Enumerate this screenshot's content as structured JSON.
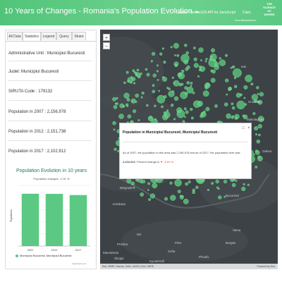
{
  "header": {
    "title": "10 Years of Changes - Romania's Population Evolution",
    "links": [
      "Calcite Theme",
      "ArcGIS API for JavaScript",
      "Claro"
    ],
    "author": "Ionut Alexandrescu",
    "logo_lines": [
      "THE",
      "SCIENCE",
      "OF",
      "WHERE"
    ]
  },
  "tabs": [
    "All Data",
    "Statistics",
    "Legend",
    "Query",
    "Share"
  ],
  "active_tab": "Statistics",
  "fields": [
    {
      "label": "Administrative Unit :",
      "value": "Municipiul Bucuresti"
    },
    {
      "label": "Judet:",
      "value": "Municipiul Bucuresti"
    },
    {
      "label": "SIRUTA Code : ",
      "value": "179132"
    },
    {
      "label": "Population in 2007 : ",
      "value": "2,156,978"
    },
    {
      "label": "Population in 2012 : ",
      "value": "2,151,738"
    },
    {
      "label": "Population in 2017 : ",
      "value": "2,102,912"
    }
  ],
  "chart_data": {
    "type": "bar",
    "title": "Population Evolution in 10 years",
    "subtitle": "Population changes: -2.51 %",
    "ylabel": "Population",
    "categories": [
      "2007",
      "2012",
      "2017"
    ],
    "series": [
      {
        "name": "Municipiul Bucuresti, Municipiul Bucuresti",
        "values": [
          2156978,
          2151738,
          2102912
        ]
      }
    ],
    "ylim": [
      0,
      2500000
    ],
    "grid": true,
    "legend_position": "bottom",
    "color": "#5bc983",
    "credit": "Highcharts.com"
  },
  "map": {
    "labels": [
      {
        "text": "Iasi"
      },
      {
        "text": "Chisinau"
      },
      {
        "text": "Odesa"
      },
      {
        "text": "Belgrade"
      },
      {
        "text": "Bucuresti"
      },
      {
        "text": "Vama"
      },
      {
        "text": "Kolubara"
      },
      {
        "text": "Nis"
      },
      {
        "text": "Burgas"
      },
      {
        "text": "Sofia"
      },
      {
        "text": "Plovdiv"
      },
      {
        "text": "Kyustendil"
      },
      {
        "text": "Skopje"
      },
      {
        "text": "Pirin"
      },
      {
        "text": "Pristina"
      },
      {
        "text": "Macedonia"
      },
      {
        "text": "Mykolayivka"
      }
    ],
    "zoom_in": "+",
    "zoom_out": "−",
    "attribution": "Esri, HERE, Garmin, NGA, USGS | Esri, HERE",
    "powered": "Powered by Esri",
    "accent": "#5bd27f"
  },
  "popup": {
    "title": "Population in Municipiul Bucuresti, Municipiul Bucuresti",
    "line1": "As of 2007, the population in this area was 2,156,978 and as of 2017, the population here was",
    "line2_value": "2,102,912",
    "line2_text": ". Percent change is",
    "change": "-2.51 %",
    "dock_icon": "dock-icon",
    "close_icon": "close-icon",
    "zoom_icon": "zoom-to-icon"
  }
}
